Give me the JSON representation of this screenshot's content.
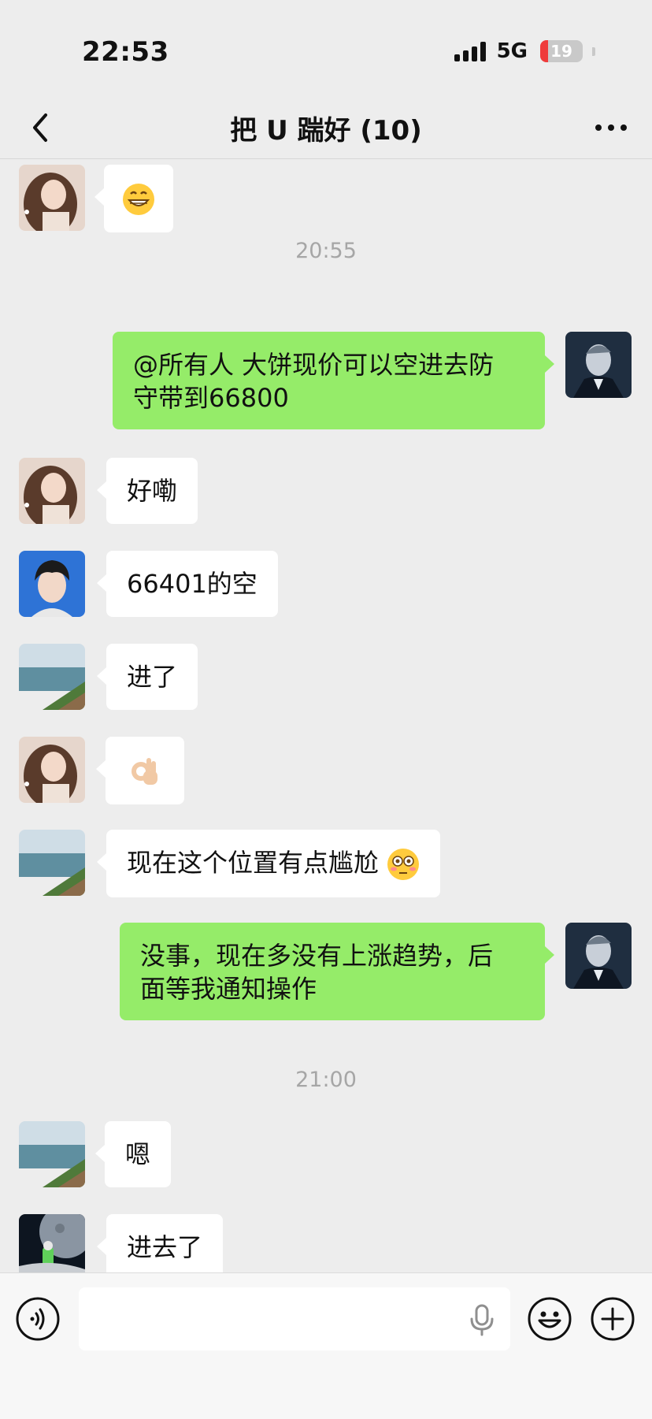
{
  "status_bar": {
    "time": "22:53",
    "network": "5G",
    "battery": "19",
    "battery_level": 0.19
  },
  "nav": {
    "title": "把 U 踹好 (10)"
  },
  "colors": {
    "background": "#ededed",
    "incoming_bubble": "#ffffff",
    "outgoing_bubble": "#95ec69"
  },
  "messages": [
    {
      "type": "in",
      "avatar": "woman-portrait-avatar",
      "emoji": "grinning-face-with-teeth"
    },
    {
      "type": "time",
      "text": "20:55"
    },
    {
      "type": "out",
      "avatar": "man-in-suit-avatar",
      "lines": [
        "@所有人 大饼现价可以空进去防",
        "守带到66800"
      ]
    },
    {
      "type": "in",
      "avatar": "woman-portrait-avatar",
      "text": "好嘞"
    },
    {
      "type": "in",
      "avatar": "young-man-portrait-avatar",
      "text": "66401的空"
    },
    {
      "type": "in",
      "avatar": "coastline-avatar",
      "text": "进了"
    },
    {
      "type": "in",
      "avatar": "woman-portrait-avatar",
      "emoji": "ok-hand"
    },
    {
      "type": "in",
      "avatar": "coastline-avatar",
      "text": "现在这个位置有点尴尬",
      "emoji": "flushed-face"
    },
    {
      "type": "out",
      "avatar": "man-in-suit-avatar",
      "lines": [
        "没事，现在多没有上涨趋势，后",
        "面等我通知操作"
      ]
    },
    {
      "type": "time",
      "text": "21:00"
    },
    {
      "type": "in",
      "avatar": "coastline-avatar",
      "text": "嗯"
    },
    {
      "type": "in",
      "avatar": "moon-astronaut-avatar",
      "text": "进去了"
    }
  ],
  "input_bar": {
    "voice": "voice-icon",
    "mic": "mic-icon",
    "emoji": "emoji-icon",
    "more": "plus-icon",
    "input_value": ""
  }
}
